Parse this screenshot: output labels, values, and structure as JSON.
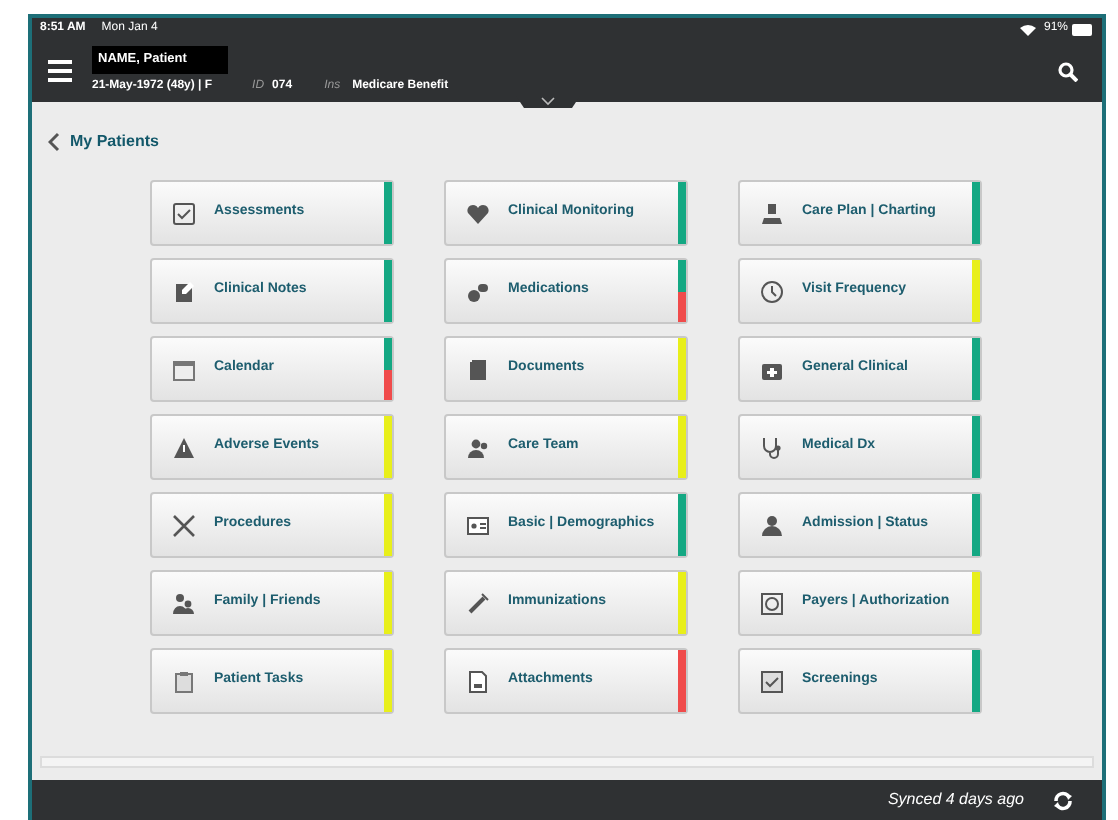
{
  "status_bar": {
    "time": "8:51 AM",
    "date": "Mon Jan 4",
    "battery": "91%"
  },
  "header": {
    "patient_name": "NAME, Patient",
    "dob": "21-May-1972 (48y) | F",
    "id_label": "ID",
    "id": "074",
    "ins_label": "Ins",
    "insurance": "Medicare Benefit"
  },
  "back_link": "My Patients",
  "tiles": [
    {
      "label": "Assessments",
      "status": [
        {
          "color": "#14a883"
        }
      ]
    },
    {
      "label": "Clinical Monitoring",
      "status": [
        {
          "color": "#14a883"
        }
      ]
    },
    {
      "label": "Care Plan | Charting",
      "status": [
        {
          "color": "#14a883"
        }
      ]
    },
    {
      "label": "Clinical Notes",
      "status": [
        {
          "color": "#14a883"
        }
      ]
    },
    {
      "label": "Medications",
      "status": [
        {
          "color": "#14a883"
        },
        {
          "color": "#f04b4b"
        }
      ]
    },
    {
      "label": "Visit Frequency",
      "status": [
        {
          "color": "#e8ef1a"
        }
      ]
    },
    {
      "label": "Calendar",
      "status": [
        {
          "color": "#14a883"
        },
        {
          "color": "#f04b4b"
        }
      ]
    },
    {
      "label": "Documents",
      "status": [
        {
          "color": "#e8ef1a"
        }
      ]
    },
    {
      "label": "General Clinical",
      "status": [
        {
          "color": "#14a883"
        }
      ]
    },
    {
      "label": "Adverse Events",
      "status": [
        {
          "color": "#e8ef1a"
        }
      ]
    },
    {
      "label": "Care Team",
      "status": [
        {
          "color": "#e8ef1a"
        }
      ]
    },
    {
      "label": "Medical Dx",
      "status": [
        {
          "color": "#14a883"
        }
      ]
    },
    {
      "label": "Procedures",
      "status": [
        {
          "color": "#e8ef1a"
        }
      ]
    },
    {
      "label": "Basic | Demographics",
      "status": [
        {
          "color": "#14a883"
        }
      ]
    },
    {
      "label": "Admission | Status",
      "status": [
        {
          "color": "#14a883"
        }
      ]
    },
    {
      "label": "Family | Friends",
      "status": [
        {
          "color": "#e8ef1a"
        }
      ]
    },
    {
      "label": "Immunizations",
      "status": [
        {
          "color": "#e8ef1a"
        }
      ]
    },
    {
      "label": "Payers | Authorization",
      "status": [
        {
          "color": "#e8ef1a"
        }
      ]
    },
    {
      "label": "Patient Tasks",
      "status": [
        {
          "color": "#e8ef1a"
        }
      ]
    },
    {
      "label": "Attachments",
      "status": [
        {
          "color": "#f04b4b"
        }
      ]
    },
    {
      "label": "Screenings",
      "status": [
        {
          "color": "#14a883"
        }
      ]
    }
  ],
  "footer": {
    "sync_text": "Synced 4 days ago"
  }
}
